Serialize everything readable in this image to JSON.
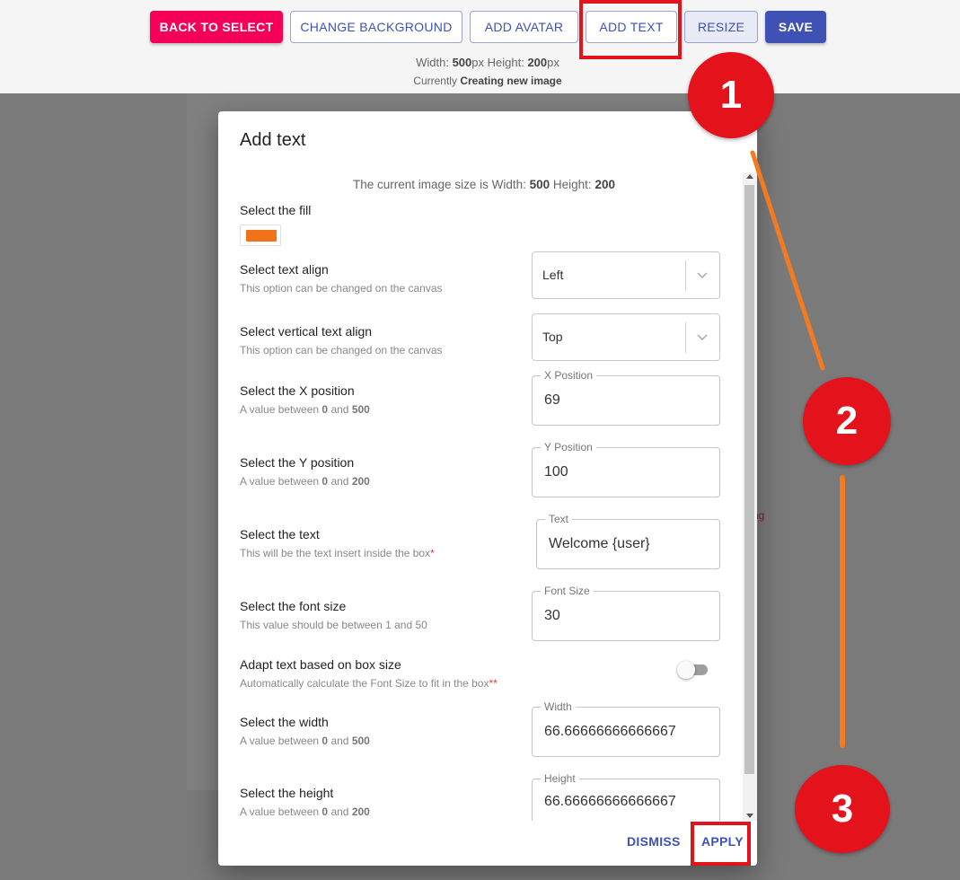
{
  "toolbar": {
    "back_label": "BACK TO SELECT",
    "change_bg_label": "CHANGE BACKGROUND",
    "add_avatar_label": "ADD AVATAR",
    "add_text_label": "ADD TEXT",
    "resize_label": "RESIZE",
    "save_label": "SAVE"
  },
  "status": {
    "width_label": "Width:",
    "width_value": "500",
    "height_label": "Height:",
    "height_value": "200",
    "unit": "px",
    "currently_label": "Currently",
    "currently_value": "Creating new image"
  },
  "background_snippet": "ting",
  "dialog": {
    "title": "Add text",
    "size_info": {
      "prefix": "The current image size is Width:",
      "width": "500",
      "height_label": "Height:",
      "height": "200"
    },
    "fill": {
      "label": "Select the fill",
      "color": "#f07319"
    },
    "text_align": {
      "label": "Select text align",
      "hint": "This option can be changed on the canvas",
      "value": "Left"
    },
    "vertical_align": {
      "label": "Select vertical text align",
      "hint": "This option can be changed on the canvas",
      "value": "Top"
    },
    "x_position": {
      "label": "Select the X position",
      "hint_prefix": "A value between",
      "min": "0",
      "and": "and",
      "max": "500",
      "field_label": "X Position",
      "value": "69"
    },
    "y_position": {
      "label": "Select the Y position",
      "hint_prefix": "A value between",
      "min": "0",
      "and": "and",
      "max": "200",
      "field_label": "Y Position",
      "value": "100"
    },
    "text": {
      "label": "Select the text",
      "hint": "This will be the text insert inside the box",
      "required_mark": "*",
      "field_label": "Text",
      "value": "Welcome {user}"
    },
    "font_size": {
      "label": "Select the font size",
      "hint": "This value should be between 1 and 50",
      "field_label": "Font Size",
      "value": "30"
    },
    "adapt": {
      "label": "Adapt text based on box size",
      "hint": "Automatically calculate the Font Size to fit in the box",
      "required_mark": "**",
      "enabled": false
    },
    "width": {
      "label": "Select the width",
      "hint_prefix": "A value between",
      "min": "0",
      "and": "and",
      "max": "500",
      "field_label": "Width",
      "value": "66.66666666666667"
    },
    "height": {
      "label": "Select the height",
      "hint_prefix": "A value between",
      "min": "0",
      "and": "and",
      "max": "200",
      "field_label": "Height",
      "value": "66.66666666666667"
    },
    "dismiss_label": "DISMISS",
    "apply_label": "APPLY"
  },
  "annotations": {
    "step1": "1",
    "step2": "2",
    "step3": "3",
    "highlight_color": "#e3121b",
    "arrow_color": "#f47a20"
  }
}
